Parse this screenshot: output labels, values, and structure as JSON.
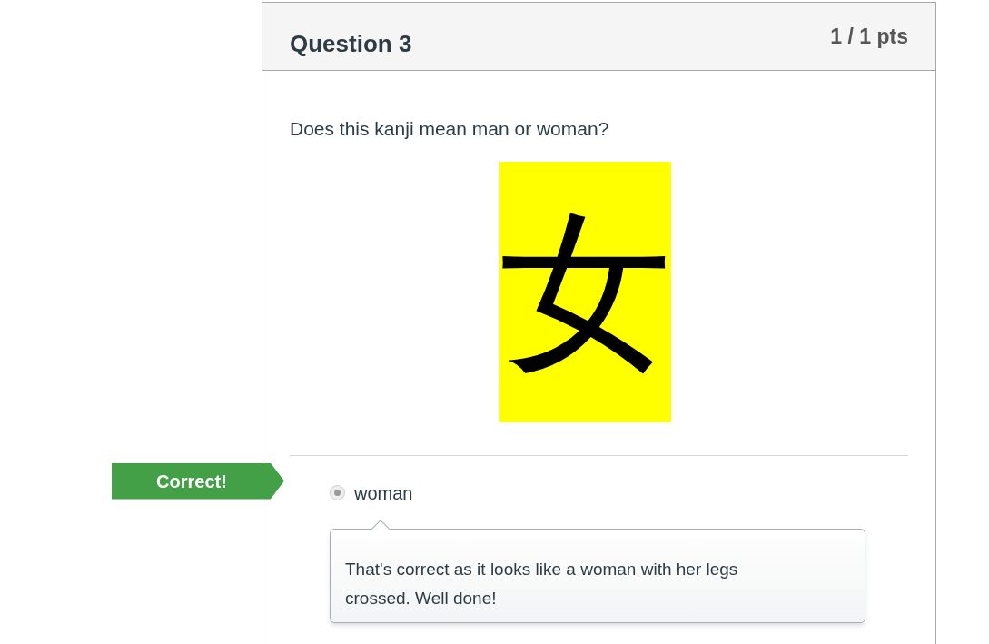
{
  "question": {
    "title": "Question 3",
    "points": "1 / 1 pts",
    "text": "Does this kanji mean man or woman?",
    "kanji": "女",
    "answers": [
      {
        "label": "woman",
        "selected": true,
        "result": "Correct!",
        "feedback": "That's correct as it looks like a woman with her legs crossed. Well done!"
      }
    ]
  }
}
